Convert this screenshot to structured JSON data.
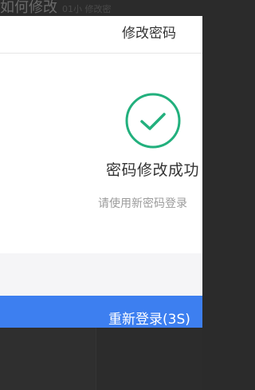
{
  "background_title": "如何修改",
  "background_meta": "01小 修改密",
  "modal": {
    "title": "修改密码",
    "success_icon": "check-circle-icon",
    "success_message": "密码修改成功",
    "hint": "请使用新密码登录",
    "relogin_button": "重新登录(3S)"
  },
  "colors": {
    "accent": "#3d7ff0",
    "success": "#22b07d",
    "overlay": "#2b2b2b"
  }
}
